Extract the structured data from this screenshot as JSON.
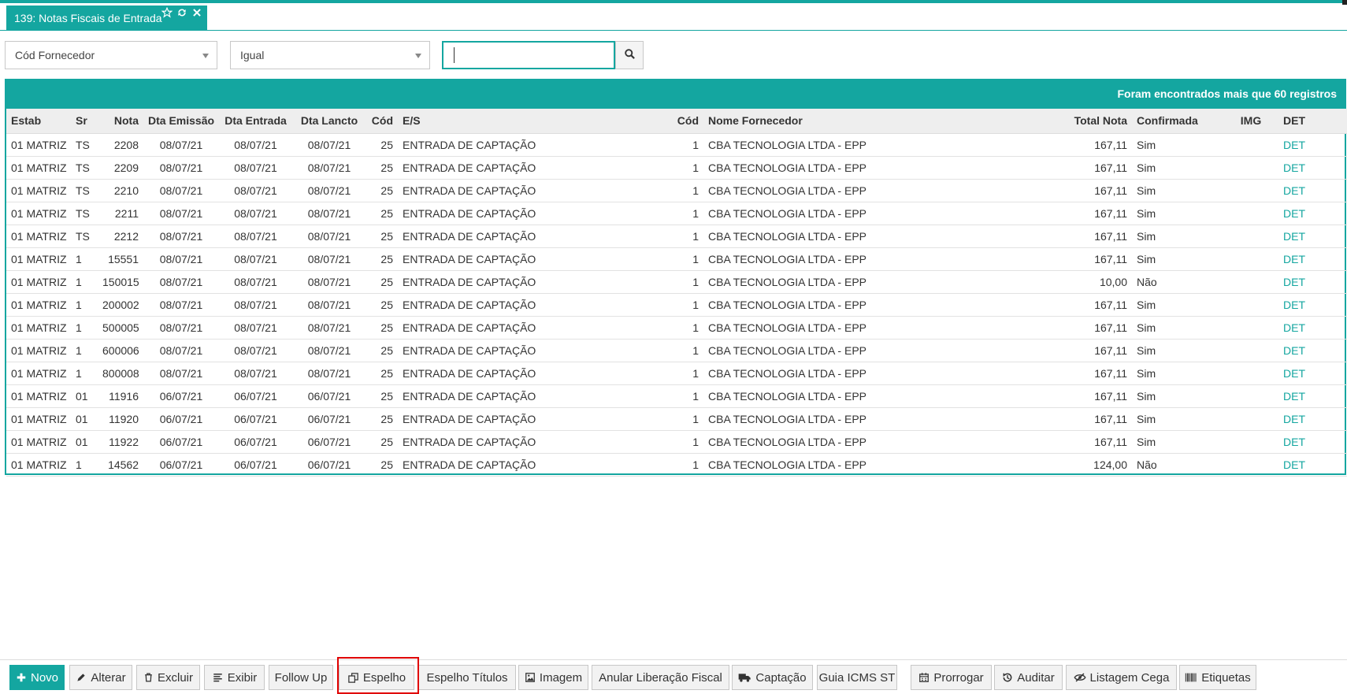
{
  "tab": {
    "title": "139: Notas Fiscais de Entrada"
  },
  "filter": {
    "field": "Cód Fornecedor",
    "operator": "Igual",
    "value": ""
  },
  "grid": {
    "banner": "Foram encontrados mais que 60 registros",
    "columns": [
      "Estab",
      "Sr",
      "Nota",
      "Dta Emissão",
      "Dta Entrada",
      "Dta Lancto",
      "Cód",
      "E/S",
      "Cód",
      "Nome Fornecedor",
      "Total Nota",
      "Confirmada",
      "IMG",
      "DET"
    ],
    "rows": [
      [
        "01 MATRIZ",
        "TS",
        "2208",
        "08/07/21",
        "08/07/21",
        "08/07/21",
        "25",
        "ENTRADA DE CAPTAÇÃO",
        "1",
        "CBA TECNOLOGIA LTDA - EPP",
        "167,11",
        "Sim",
        "",
        "DET"
      ],
      [
        "01 MATRIZ",
        "TS",
        "2209",
        "08/07/21",
        "08/07/21",
        "08/07/21",
        "25",
        "ENTRADA DE CAPTAÇÃO",
        "1",
        "CBA TECNOLOGIA LTDA - EPP",
        "167,11",
        "Sim",
        "",
        "DET"
      ],
      [
        "01 MATRIZ",
        "TS",
        "2210",
        "08/07/21",
        "08/07/21",
        "08/07/21",
        "25",
        "ENTRADA DE CAPTAÇÃO",
        "1",
        "CBA TECNOLOGIA LTDA - EPP",
        "167,11",
        "Sim",
        "",
        "DET"
      ],
      [
        "01 MATRIZ",
        "TS",
        "2211",
        "08/07/21",
        "08/07/21",
        "08/07/21",
        "25",
        "ENTRADA DE CAPTAÇÃO",
        "1",
        "CBA TECNOLOGIA LTDA - EPP",
        "167,11",
        "Sim",
        "",
        "DET"
      ],
      [
        "01 MATRIZ",
        "TS",
        "2212",
        "08/07/21",
        "08/07/21",
        "08/07/21",
        "25",
        "ENTRADA DE CAPTAÇÃO",
        "1",
        "CBA TECNOLOGIA LTDA - EPP",
        "167,11",
        "Sim",
        "",
        "DET"
      ],
      [
        "01 MATRIZ",
        "1",
        "15551",
        "08/07/21",
        "08/07/21",
        "08/07/21",
        "25",
        "ENTRADA DE CAPTAÇÃO",
        "1",
        "CBA TECNOLOGIA LTDA - EPP",
        "167,11",
        "Sim",
        "",
        "DET"
      ],
      [
        "01 MATRIZ",
        "1",
        "150015",
        "08/07/21",
        "08/07/21",
        "08/07/21",
        "25",
        "ENTRADA DE CAPTAÇÃO",
        "1",
        "CBA TECNOLOGIA LTDA - EPP",
        "10,00",
        "Não",
        "",
        "DET"
      ],
      [
        "01 MATRIZ",
        "1",
        "200002",
        "08/07/21",
        "08/07/21",
        "08/07/21",
        "25",
        "ENTRADA DE CAPTAÇÃO",
        "1",
        "CBA TECNOLOGIA LTDA - EPP",
        "167,11",
        "Sim",
        "",
        "DET"
      ],
      [
        "01 MATRIZ",
        "1",
        "500005",
        "08/07/21",
        "08/07/21",
        "08/07/21",
        "25",
        "ENTRADA DE CAPTAÇÃO",
        "1",
        "CBA TECNOLOGIA LTDA - EPP",
        "167,11",
        "Sim",
        "",
        "DET"
      ],
      [
        "01 MATRIZ",
        "1",
        "600006",
        "08/07/21",
        "08/07/21",
        "08/07/21",
        "25",
        "ENTRADA DE CAPTAÇÃO",
        "1",
        "CBA TECNOLOGIA LTDA - EPP",
        "167,11",
        "Sim",
        "",
        "DET"
      ],
      [
        "01 MATRIZ",
        "1",
        "800008",
        "08/07/21",
        "08/07/21",
        "08/07/21",
        "25",
        "ENTRADA DE CAPTAÇÃO",
        "1",
        "CBA TECNOLOGIA LTDA - EPP",
        "167,11",
        "Sim",
        "",
        "DET"
      ],
      [
        "01 MATRIZ",
        "01",
        "11916",
        "06/07/21",
        "06/07/21",
        "06/07/21",
        "25",
        "ENTRADA DE CAPTAÇÃO",
        "1",
        "CBA TECNOLOGIA LTDA - EPP",
        "167,11",
        "Sim",
        "",
        "DET"
      ],
      [
        "01 MATRIZ",
        "01",
        "11920",
        "06/07/21",
        "06/07/21",
        "06/07/21",
        "25",
        "ENTRADA DE CAPTAÇÃO",
        "1",
        "CBA TECNOLOGIA LTDA - EPP",
        "167,11",
        "Sim",
        "",
        "DET"
      ],
      [
        "01 MATRIZ",
        "01",
        "11922",
        "06/07/21",
        "06/07/21",
        "06/07/21",
        "25",
        "ENTRADA DE CAPTAÇÃO",
        "1",
        "CBA TECNOLOGIA LTDA - EPP",
        "167,11",
        "Sim",
        "",
        "DET"
      ],
      [
        "01 MATRIZ",
        "1",
        "14562",
        "06/07/21",
        "06/07/21",
        "06/07/21",
        "25",
        "ENTRADA DE CAPTAÇÃO",
        "1",
        "CBA TECNOLOGIA LTDA - EPP",
        "124,00",
        "Não",
        "",
        "DET"
      ]
    ]
  },
  "toolbar": {
    "buttons": [
      {
        "label": "Novo",
        "icon": "plus-icon"
      },
      {
        "label": "Alterar",
        "icon": "pencil-icon"
      },
      {
        "label": "Excluir",
        "icon": "trash-icon"
      },
      {
        "label": "Exibir",
        "icon": "list-icon"
      },
      {
        "label": "Follow Up",
        "icon": ""
      },
      {
        "label": "Espelho",
        "icon": "copy-icon"
      },
      {
        "label": "Espelho Títulos",
        "icon": ""
      },
      {
        "label": "Imagem",
        "icon": "image-icon"
      },
      {
        "label": "Anular Liberação Fiscal",
        "icon": ""
      },
      {
        "label": "Captação",
        "icon": "truck-icon"
      },
      {
        "label": "Guia ICMS ST",
        "icon": ""
      },
      {
        "label": "Prorrogar",
        "icon": "calendar-icon"
      },
      {
        "label": "Auditar",
        "icon": "history-icon"
      },
      {
        "label": "Listagem Cega",
        "icon": "eye-slash-icon"
      },
      {
        "label": "Etiquetas",
        "icon": "barcode-icon"
      }
    ]
  },
  "colors": {
    "accent": "#14a6a0",
    "highlight": "#e00000"
  }
}
